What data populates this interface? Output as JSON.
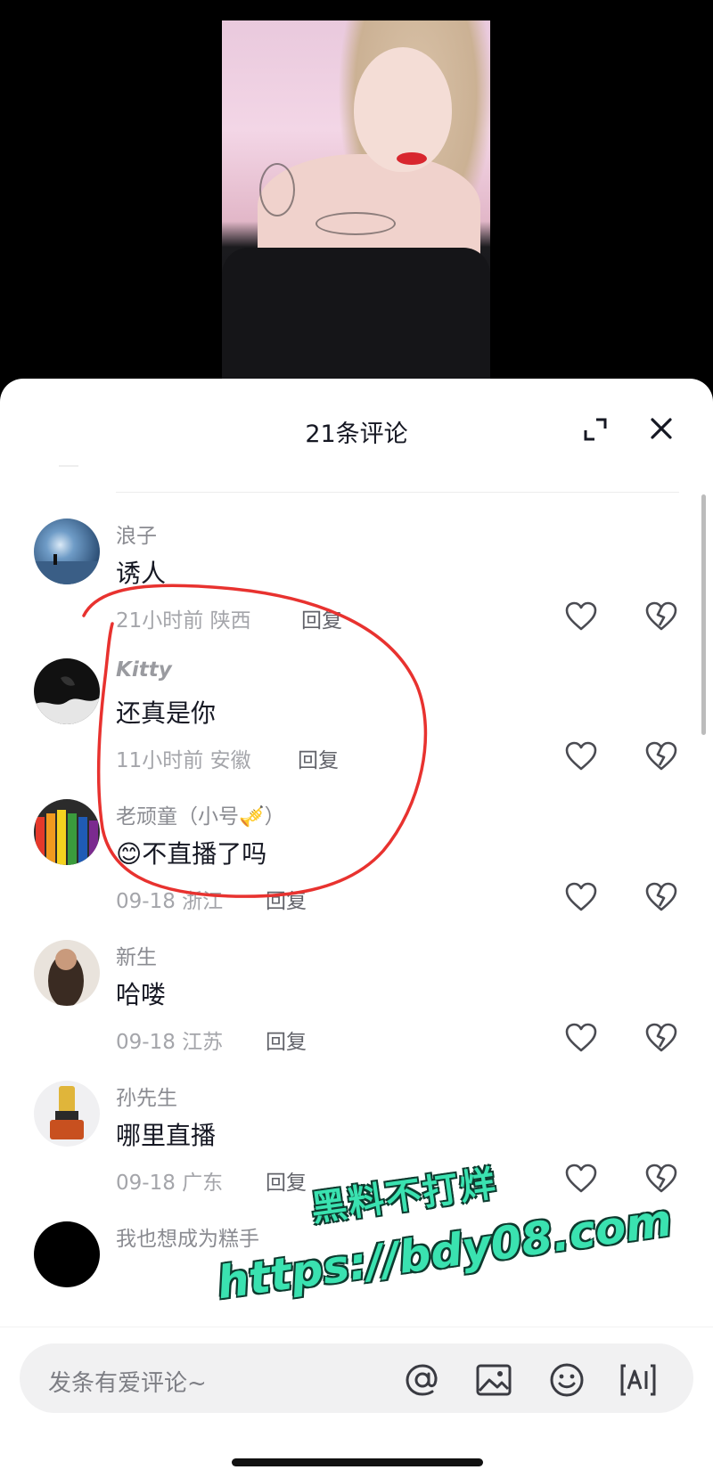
{
  "header": {
    "title": "21条评论"
  },
  "comments": [
    {
      "username": "浪子",
      "text": "诱人",
      "time": "21小时前",
      "location": "陕西",
      "reply_label": "回复"
    },
    {
      "username": "Kitty",
      "text": "还真是你",
      "time": "11小时前",
      "location": "安徽",
      "reply_label": "回复"
    },
    {
      "username": "老顽童（小号🎺）",
      "emoji": "😊",
      "text": "不直播了吗",
      "time": "09-18",
      "location": "浙江",
      "reply_label": "回复"
    },
    {
      "username": "新生",
      "text": "哈喽",
      "time": "09-18",
      "location": "江苏",
      "reply_label": "回复"
    },
    {
      "username": "孙先生",
      "text": "哪里直播",
      "time": "09-18",
      "location": "广东",
      "reply_label": "回复"
    },
    {
      "username": "我也想成为糕手"
    }
  ],
  "watermark": {
    "line1": "黑料不打烊",
    "line2": "https://bdy08.com"
  },
  "input": {
    "placeholder": "发条有爱评论~"
  },
  "icons": [
    "expand-icon",
    "close-icon",
    "heart-icon",
    "broken-heart-icon",
    "at-icon",
    "image-icon",
    "emoji-icon",
    "ai-icon"
  ],
  "colors": {
    "annotation": "#e8322f",
    "watermark": "#3ae2b0"
  }
}
